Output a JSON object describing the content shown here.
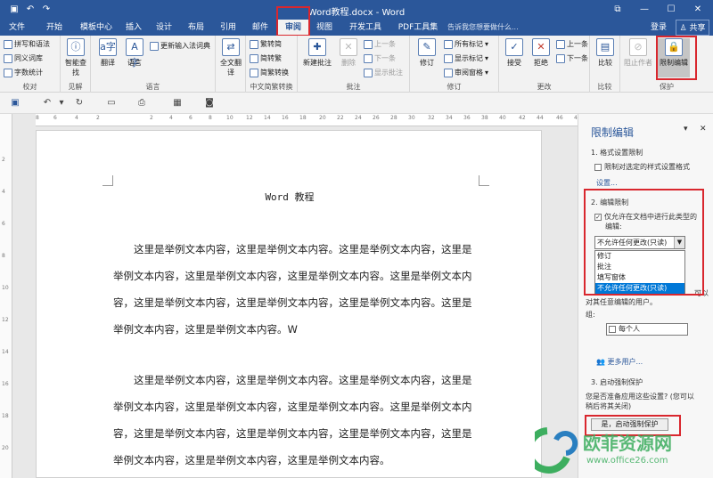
{
  "window": {
    "title": "Word教程.docx - Word",
    "controls": [
      "⧉",
      "—",
      "☐",
      "✕"
    ]
  },
  "tabs": [
    {
      "label": "文件"
    },
    {
      "label": "开始"
    },
    {
      "label": "模板中心"
    },
    {
      "label": "插入"
    },
    {
      "label": "设计"
    },
    {
      "label": "布局"
    },
    {
      "label": "引用"
    },
    {
      "label": "邮件"
    },
    {
      "label": "审阅"
    },
    {
      "label": "视图"
    },
    {
      "label": "开发工具"
    },
    {
      "label": "PDF工具集"
    }
  ],
  "tellme": "告诉我您想要做什么...",
  "account": {
    "login": "登录",
    "share": "共享"
  },
  "ribbon": {
    "proofing": {
      "spell": "拼写和语法",
      "thesaurus": "同义词库",
      "wordcount": "字数统计",
      "label": "校对"
    },
    "insights": {
      "smart": "智能查找",
      "label": "见解"
    },
    "language": {
      "translate": "翻译",
      "lang": "语言",
      "ime": "更新输入法词典",
      "label": "语言"
    },
    "fullwidth": {
      "text": "全文翻译"
    },
    "chinese": {
      "t2s": "繁转简",
      "s2t": "简转繁",
      "convert": "简繁转换",
      "label": "中文简繁转换"
    },
    "comments": {
      "new": "新建批注",
      "delete": "删除",
      "prev": "上一条",
      "next": "下一条",
      "show": "显示批注",
      "label": "批注"
    },
    "tracking": {
      "track": "修订",
      "all": "所有标记",
      "showmarkup": "显示标记",
      "pane": "审阅窗格",
      "label": "修订"
    },
    "changes": {
      "accept": "接受",
      "reject": "拒绝",
      "prev": "上一条",
      "next": "下一条",
      "label": "更改"
    },
    "compare": {
      "compare": "比较",
      "label": "比较"
    },
    "protect": {
      "block": "阻止作者",
      "restrict": "限制编辑",
      "label": "保护"
    }
  },
  "ruler": {
    "h": [
      "8",
      "6",
      "4",
      "2",
      "2",
      "4",
      "6",
      "8",
      "10",
      "12",
      "14",
      "16",
      "18",
      "20",
      "22",
      "24",
      "26",
      "28",
      "30",
      "32",
      "34",
      "36",
      "38",
      "40",
      "42",
      "44",
      "46",
      "48"
    ],
    "v": [
      "2",
      "4",
      "6",
      "8",
      "10",
      "12",
      "14",
      "16",
      "18",
      "20"
    ]
  },
  "document": {
    "title": "Word 教程",
    "paragraphs": [
      "这里是举例文本内容，这里是举例文本内容。这里是举例文本内容，这里是举例文本内容，这里是举例文本内容，这里是举例文本内容。这里是举例文本内容，这里是举例文本内容，这里是举例文本内容，这里是举例文本内容。这里是举例文本内容，这里是举例文本内容。W",
      "这里是举例文本内容，这里是举例文本内容。这里是举例文本内容，这里是举例文本内容，这里是举例文本内容，这里是举例文本内容。这里是举例文本内容，这里是举例文本内容，这里是举例文本内容，这里是举例文本内容，这里是举例文本内容，这里是举例文本内容，这里是举例文本内容。"
    ]
  },
  "pane": {
    "title": "限制编辑",
    "s1": "1. 格式设置限制",
    "s1_check": "限制对选定的样式设置格式",
    "s1_link": "设置...",
    "s2": "2. 编辑限制",
    "s2_check_line1": "仅允许在文档中进行此类型的",
    "s2_check_line2": "编辑:",
    "dropdown_value": "不允许任何更改(只读)",
    "options": [
      "修订",
      "批注",
      "填写窗体",
      "不允许任何更改(只读)"
    ],
    "exceptions_tail": "可以",
    "exceptions_line": "对其任意编辑的用户。",
    "group_label": "组:",
    "group_value": "每个人",
    "more_users": "更多用户...",
    "s3": "3. 启动强制保护",
    "s3_question_line1": "您是否准备应用这些设置? (您可以",
    "s3_question_line2": "稍后将其关闭)",
    "start_button": "是，启动强制保护"
  },
  "watermark": {
    "brand": "欧菲资源网",
    "url": "www.office26.com"
  },
  "colors": {
    "accent": "#2b579a",
    "highlight": "#d9272e",
    "watermark_green": "#3dae5f",
    "watermark_blue": "#2a7fc0"
  }
}
